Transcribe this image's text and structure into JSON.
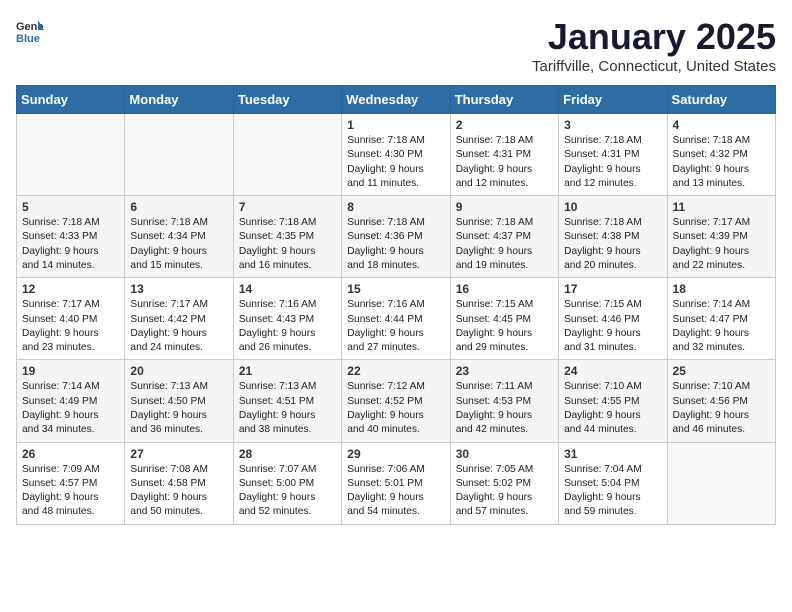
{
  "logo": {
    "general": "General",
    "blue": "Blue"
  },
  "title": "January 2025",
  "location": "Tariffville, Connecticut, United States",
  "weekdays": [
    "Sunday",
    "Monday",
    "Tuesday",
    "Wednesday",
    "Thursday",
    "Friday",
    "Saturday"
  ],
  "weeks": [
    [
      {
        "day": "",
        "info": ""
      },
      {
        "day": "",
        "info": ""
      },
      {
        "day": "",
        "info": ""
      },
      {
        "day": "1",
        "info": "Sunrise: 7:18 AM\nSunset: 4:30 PM\nDaylight: 9 hours\nand 11 minutes."
      },
      {
        "day": "2",
        "info": "Sunrise: 7:18 AM\nSunset: 4:31 PM\nDaylight: 9 hours\nand 12 minutes."
      },
      {
        "day": "3",
        "info": "Sunrise: 7:18 AM\nSunset: 4:31 PM\nDaylight: 9 hours\nand 12 minutes."
      },
      {
        "day": "4",
        "info": "Sunrise: 7:18 AM\nSunset: 4:32 PM\nDaylight: 9 hours\nand 13 minutes."
      }
    ],
    [
      {
        "day": "5",
        "info": "Sunrise: 7:18 AM\nSunset: 4:33 PM\nDaylight: 9 hours\nand 14 minutes."
      },
      {
        "day": "6",
        "info": "Sunrise: 7:18 AM\nSunset: 4:34 PM\nDaylight: 9 hours\nand 15 minutes."
      },
      {
        "day": "7",
        "info": "Sunrise: 7:18 AM\nSunset: 4:35 PM\nDaylight: 9 hours\nand 16 minutes."
      },
      {
        "day": "8",
        "info": "Sunrise: 7:18 AM\nSunset: 4:36 PM\nDaylight: 9 hours\nand 18 minutes."
      },
      {
        "day": "9",
        "info": "Sunrise: 7:18 AM\nSunset: 4:37 PM\nDaylight: 9 hours\nand 19 minutes."
      },
      {
        "day": "10",
        "info": "Sunrise: 7:18 AM\nSunset: 4:38 PM\nDaylight: 9 hours\nand 20 minutes."
      },
      {
        "day": "11",
        "info": "Sunrise: 7:17 AM\nSunset: 4:39 PM\nDaylight: 9 hours\nand 22 minutes."
      }
    ],
    [
      {
        "day": "12",
        "info": "Sunrise: 7:17 AM\nSunset: 4:40 PM\nDaylight: 9 hours\nand 23 minutes."
      },
      {
        "day": "13",
        "info": "Sunrise: 7:17 AM\nSunset: 4:42 PM\nDaylight: 9 hours\nand 24 minutes."
      },
      {
        "day": "14",
        "info": "Sunrise: 7:16 AM\nSunset: 4:43 PM\nDaylight: 9 hours\nand 26 minutes."
      },
      {
        "day": "15",
        "info": "Sunrise: 7:16 AM\nSunset: 4:44 PM\nDaylight: 9 hours\nand 27 minutes."
      },
      {
        "day": "16",
        "info": "Sunrise: 7:15 AM\nSunset: 4:45 PM\nDaylight: 9 hours\nand 29 minutes."
      },
      {
        "day": "17",
        "info": "Sunrise: 7:15 AM\nSunset: 4:46 PM\nDaylight: 9 hours\nand 31 minutes."
      },
      {
        "day": "18",
        "info": "Sunrise: 7:14 AM\nSunset: 4:47 PM\nDaylight: 9 hours\nand 32 minutes."
      }
    ],
    [
      {
        "day": "19",
        "info": "Sunrise: 7:14 AM\nSunset: 4:49 PM\nDaylight: 9 hours\nand 34 minutes."
      },
      {
        "day": "20",
        "info": "Sunrise: 7:13 AM\nSunset: 4:50 PM\nDaylight: 9 hours\nand 36 minutes."
      },
      {
        "day": "21",
        "info": "Sunrise: 7:13 AM\nSunset: 4:51 PM\nDaylight: 9 hours\nand 38 minutes."
      },
      {
        "day": "22",
        "info": "Sunrise: 7:12 AM\nSunset: 4:52 PM\nDaylight: 9 hours\nand 40 minutes."
      },
      {
        "day": "23",
        "info": "Sunrise: 7:11 AM\nSunset: 4:53 PM\nDaylight: 9 hours\nand 42 minutes."
      },
      {
        "day": "24",
        "info": "Sunrise: 7:10 AM\nSunset: 4:55 PM\nDaylight: 9 hours\nand 44 minutes."
      },
      {
        "day": "25",
        "info": "Sunrise: 7:10 AM\nSunset: 4:56 PM\nDaylight: 9 hours\nand 46 minutes."
      }
    ],
    [
      {
        "day": "26",
        "info": "Sunrise: 7:09 AM\nSunset: 4:57 PM\nDaylight: 9 hours\nand 48 minutes."
      },
      {
        "day": "27",
        "info": "Sunrise: 7:08 AM\nSunset: 4:58 PM\nDaylight: 9 hours\nand 50 minutes."
      },
      {
        "day": "28",
        "info": "Sunrise: 7:07 AM\nSunset: 5:00 PM\nDaylight: 9 hours\nand 52 minutes."
      },
      {
        "day": "29",
        "info": "Sunrise: 7:06 AM\nSunset: 5:01 PM\nDaylight: 9 hours\nand 54 minutes."
      },
      {
        "day": "30",
        "info": "Sunrise: 7:05 AM\nSunset: 5:02 PM\nDaylight: 9 hours\nand 57 minutes."
      },
      {
        "day": "31",
        "info": "Sunrise: 7:04 AM\nSunset: 5:04 PM\nDaylight: 9 hours\nand 59 minutes."
      },
      {
        "day": "",
        "info": ""
      }
    ]
  ]
}
